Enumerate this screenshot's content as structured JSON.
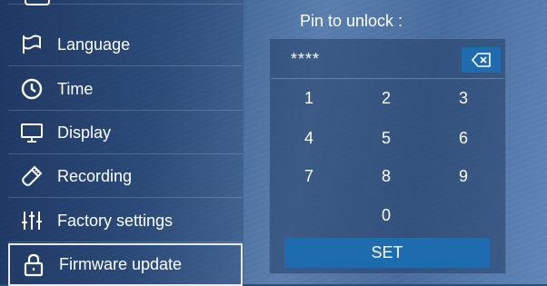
{
  "menu": {
    "items": [
      {
        "label": "Language",
        "icon": "flag-icon"
      },
      {
        "label": "Time",
        "icon": "clock-icon"
      },
      {
        "label": "Display",
        "icon": "monitor-icon"
      },
      {
        "label": "Recording",
        "icon": "usb-drive-icon"
      },
      {
        "label": "Factory settings",
        "icon": "sliders-icon"
      },
      {
        "label": "Firmware update",
        "icon": "lock-icon",
        "selected": true
      }
    ]
  },
  "pin": {
    "title": "Pin to unlock :",
    "value": "****",
    "keys": [
      "1",
      "2",
      "3",
      "4",
      "5",
      "6",
      "7",
      "8",
      "9",
      "0"
    ],
    "set_label": "SET",
    "backspace_icon": "backspace-icon"
  },
  "colors": {
    "accent": "#1e6bb0",
    "text": "#ffffff"
  }
}
